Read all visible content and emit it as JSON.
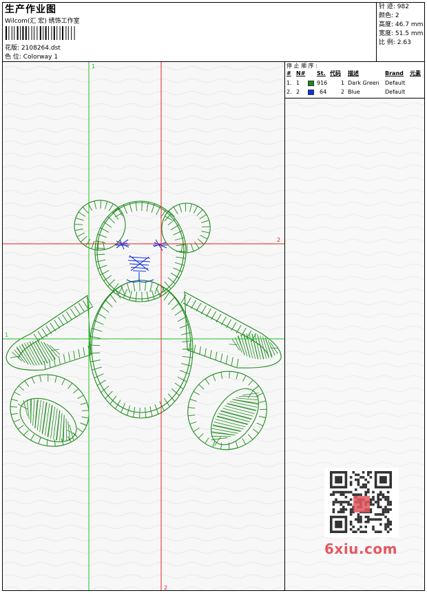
{
  "header": {
    "title": "生产作业图",
    "studio": "Wilcom(汇 宏) 绣饰工作室",
    "design_label": "花版:",
    "design_file": "2108264.dst",
    "colorway_label": "色 位:",
    "colorway": "Colorway 1"
  },
  "stats": [
    {
      "label": "针 迹:",
      "value": "982"
    },
    {
      "label": "颜色:",
      "value": "2"
    },
    {
      "label": "高度:",
      "value": "46.7 mm"
    },
    {
      "label": "宽度:",
      "value": "51.5 mm"
    },
    {
      "label": "比 例:",
      "value": "2.63"
    }
  ],
  "stop_sequence": {
    "title": "停 止 顺 序 :",
    "columns": [
      "#",
      "N#",
      "St.",
      "代码",
      "描述",
      "Brand",
      "元素"
    ],
    "rows": [
      {
        "index": "1.",
        "needle": "1",
        "color": "#1a8a1a",
        "stitches": "916",
        "code": "1",
        "description": "Dark Green",
        "brand": "Default"
      },
      {
        "index": "2.",
        "needle": "2",
        "color": "#1030e0",
        "stitches": "64",
        "code": "2",
        "description": "Blue",
        "brand": "Default"
      }
    ]
  },
  "guides": {
    "vertical_green": "1",
    "vertical_red": "2",
    "horizontal_red": "2",
    "horizontal_green": "1"
  },
  "colors": {
    "thread_green": "#1a8a1a",
    "thread_blue": "#1030e0",
    "guide_green": "#22c022",
    "guide_red": "#e02020",
    "watermark": "#e4585f"
  },
  "watermark": {
    "text": "6xiu.com",
    "stamp": "绣秀图库"
  }
}
